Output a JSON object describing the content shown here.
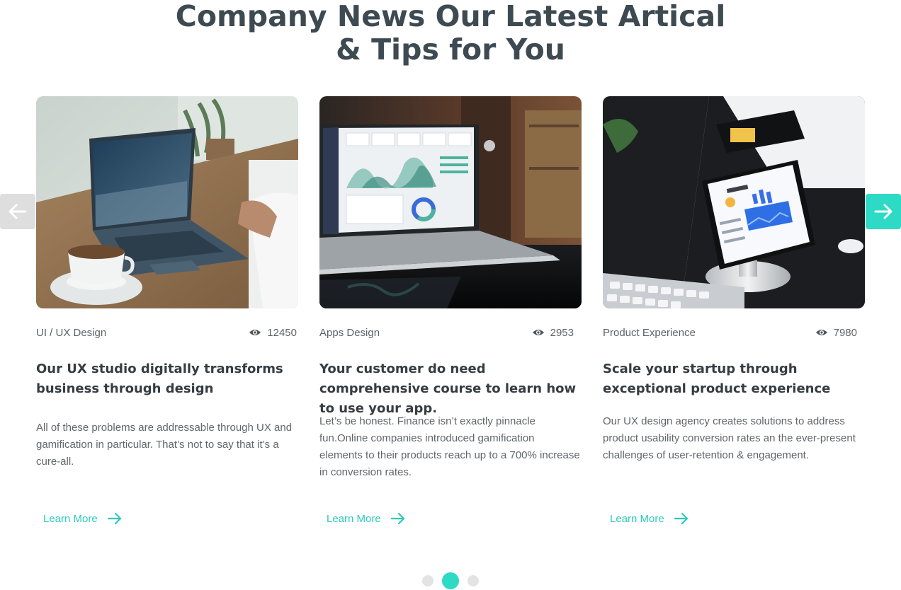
{
  "section": {
    "title_line1": "Company News Our Latest Artical",
    "title_line2": "& Tips for You"
  },
  "carousel": {
    "prev_icon": "arrow-left-icon",
    "next_icon": "arrow-right-icon",
    "accent_color": "#2ddac6",
    "active_page": 2,
    "page_count": 3
  },
  "cards": [
    {
      "image": "laptop-with-coffee-cup",
      "category": "UI / UX Design",
      "views": "12450",
      "title": "Our UX studio digitally transforms business through design",
      "description": "All of these problems are addressable through UX and gamification in particular. That’s not to say that it’s a cure-all.",
      "link_label": "Learn More"
    },
    {
      "image": "laptop-with-analytics-dashboard",
      "category": "Apps Design",
      "views": "2953",
      "title": "Your customer do need comprehensive course to learn how to use your app.",
      "description": "Let’s be honest. Finance isn’t exactly pinnacle fun.Online companies introduced gamification elements to their products reach up to a 700% increase in conversion rates.",
      "link_label": "Learn More"
    },
    {
      "image": "phone-on-stand-live-data",
      "category": "Product Experience",
      "views": "7980",
      "title": "Scale your startup through exceptional product experience",
      "description": "Our UX design agency creates solutions to address product usability conversion rates an the ever-present challenges of user-retention & engagement.",
      "link_label": "Learn More"
    }
  ]
}
